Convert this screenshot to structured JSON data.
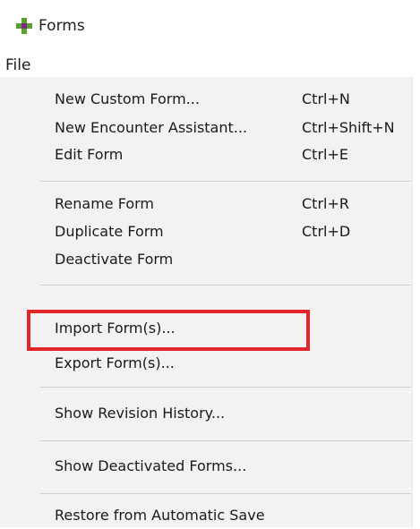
{
  "window": {
    "title": "Forms",
    "icon": "forms-app-icon"
  },
  "menubar": {
    "file_label": "File"
  },
  "menu": {
    "items": [
      {
        "label": "New Custom Form...",
        "shortcut": "Ctrl+N"
      },
      {
        "label": "New Encounter Assistant...",
        "shortcut": "Ctrl+Shift+N"
      },
      {
        "label": "Edit Form",
        "shortcut": "Ctrl+E"
      },
      {
        "label": "Rename Form",
        "shortcut": "Ctrl+R"
      },
      {
        "label": "Duplicate Form",
        "shortcut": "Ctrl+D"
      },
      {
        "label": "Deactivate Form",
        "shortcut": ""
      },
      {
        "label": "Import Form(s)...",
        "shortcut": ""
      },
      {
        "label": "Export Form(s)...",
        "shortcut": ""
      },
      {
        "label": "Show Revision History...",
        "shortcut": ""
      },
      {
        "label": "Show Deactivated Forms...",
        "shortcut": ""
      },
      {
        "label": "Restore from Automatic Save",
        "shortcut": ""
      }
    ]
  },
  "colors": {
    "menu_background": "#f2f2f2",
    "separator": "#cfcfcf",
    "highlight_border": "#e3242b",
    "icon_green": "#5aa02c",
    "icon_purple": "#7b2a8c"
  }
}
